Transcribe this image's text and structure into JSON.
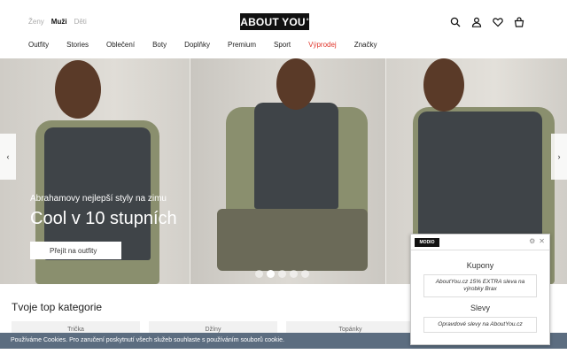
{
  "header": {
    "gender_tabs": [
      "Ženy",
      "Muži",
      "Děti"
    ],
    "logo": "ABOUT YOU",
    "logo_mark": "°",
    "nav": [
      "Outfity",
      "Stories",
      "Oblečení",
      "Boty",
      "Doplňky",
      "Premium",
      "Sport",
      "Výprodej",
      "Značky"
    ]
  },
  "hero": {
    "arrow_left": "‹",
    "arrow_right": "›",
    "subtitle": "Abrahamovy nejlepší styly na zimu",
    "title": "Cool v 10 stupních",
    "button": "Přejít na outfity",
    "slides_total": 5,
    "slide_active": 2
  },
  "categories": {
    "heading": "Tvoje top kategorie",
    "items": [
      "Trička",
      "Džíny",
      "Topánky"
    ]
  },
  "cookie": {
    "text": "Používáme Cookies. Pro zaručení poskytnutí všech služeb souhlaste s používáním souborů cookie."
  },
  "popup": {
    "logo": "MODIO",
    "settings": "⚙",
    "close": "✕",
    "coupons_title": "Kupony",
    "coupon_text": "AboutYou.cz 15% EXTRA sleva na výrobky Brax",
    "discounts_title": "Slevy",
    "discount_text": "Opravdové slevy na AboutYou.cz"
  },
  "colors": {
    "accent_sale": "#e0342a",
    "cookie_bar": "#5c6d80"
  }
}
